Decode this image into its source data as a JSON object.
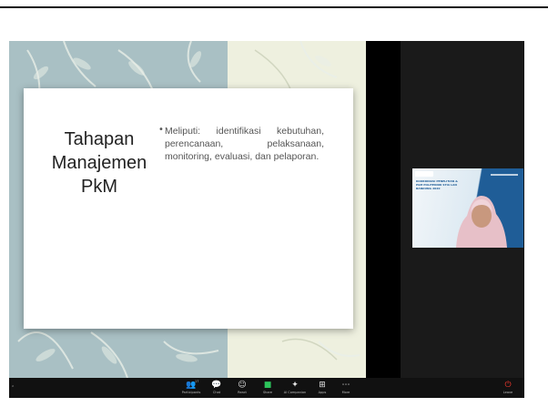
{
  "slide": {
    "title_lines": [
      "Tahapan",
      "Manajemen",
      "PkM"
    ],
    "bullet": "Meliputi: identifikasi kebutuhan, perencanaan, pelaksanaan, monitoring, evaluasi, dan pelaporan."
  },
  "video_tile": {
    "banner_text": "KOORDINASI PENELITIAN & PkM POLITEKNIK STIA LAN BANDUNG 2020"
  },
  "toolbar": {
    "participants_label": "Participants",
    "participants_count": "17",
    "chat_label": "Chat",
    "react_label": "React",
    "share_label": "Share",
    "ai_label": "AI Companion",
    "apps_label": "Apps",
    "more_label": "More",
    "leave_label": "Leave"
  },
  "colors": {
    "slide_left_bg": "#a9c0c4",
    "slide_right_bg": "#eef0df",
    "toolbar_bg": "#111111",
    "share_green": "#2cc35b",
    "leave_red": "#ff3b30",
    "banner_blue": "#1f5d97"
  },
  "icons": {
    "participants": "people-icon",
    "chat": "chat-bubble-icon",
    "react": "smiley-icon",
    "share": "share-screen-icon",
    "ai": "sparkle-icon",
    "apps": "apps-grid-icon",
    "more": "more-dots-icon",
    "leave": "leave-icon"
  }
}
